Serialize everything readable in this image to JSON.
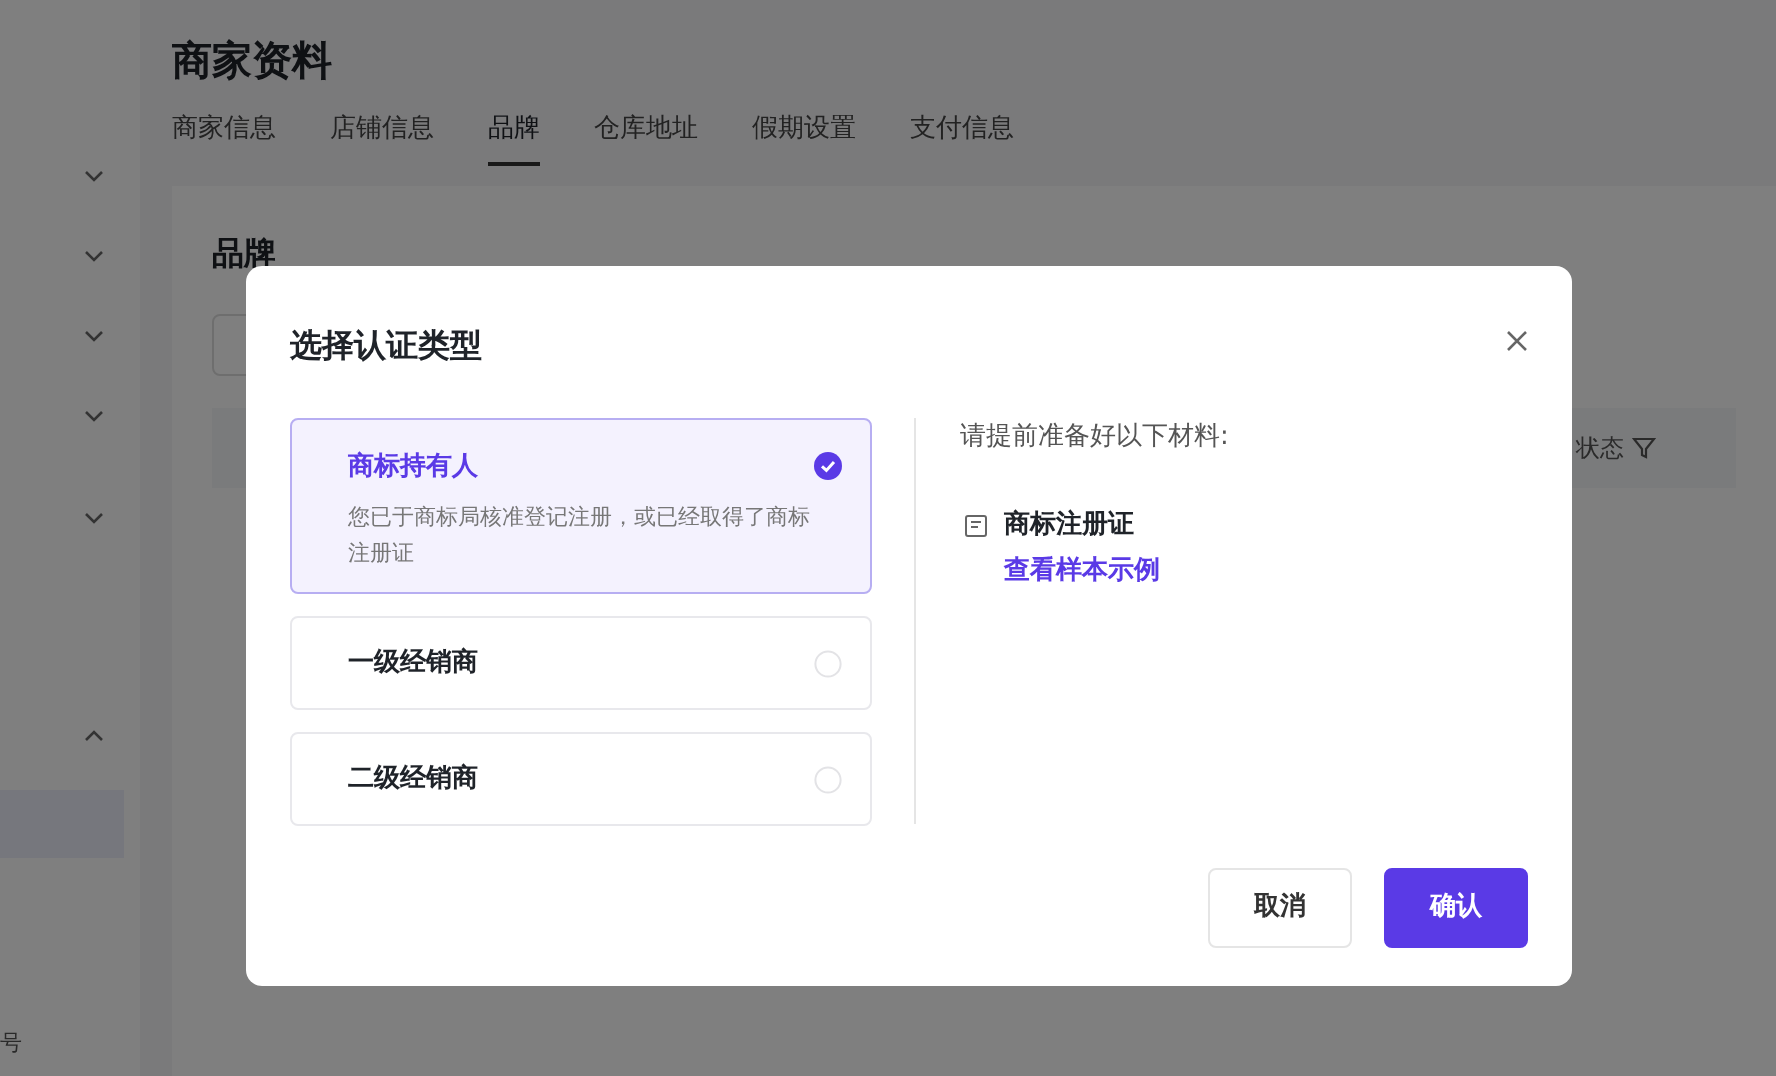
{
  "sidebar": {
    "items": [
      {
        "expanded": false
      },
      {
        "expanded": false
      },
      {
        "expanded": false
      },
      {
        "expanded": false
      },
      {
        "expanded": false
      },
      {
        "expanded": true
      }
    ],
    "partial_label": "号"
  },
  "page": {
    "title": "商家资料",
    "tabs": [
      {
        "label": "商家信息",
        "selected": false
      },
      {
        "label": "店铺信息",
        "selected": false
      },
      {
        "label": "品牌",
        "selected": true
      },
      {
        "label": "仓库地址",
        "selected": false
      },
      {
        "label": "假期设置",
        "selected": false
      },
      {
        "label": "支付信息",
        "selected": false
      }
    ],
    "card_title": "品牌",
    "table": {
      "columns": [
        {
          "label": "状态"
        }
      ]
    }
  },
  "dialog": {
    "title": "选择认证类型",
    "options": [
      {
        "label": "商标持有人",
        "description": "您已于商标局核准登记注册，或已经取得了商标注册证",
        "selected": true
      },
      {
        "label": "一级经销商",
        "selected": false
      },
      {
        "label": "二级经销商",
        "selected": false
      }
    ],
    "materials_heading": "请提前准备好以下材料:",
    "materials": [
      {
        "name": "商标注册证",
        "link": "查看样本示例"
      }
    ],
    "buttons": [
      {
        "label": "取消",
        "kind": "secondary"
      },
      {
        "label": "确认",
        "kind": "primary"
      }
    ]
  }
}
